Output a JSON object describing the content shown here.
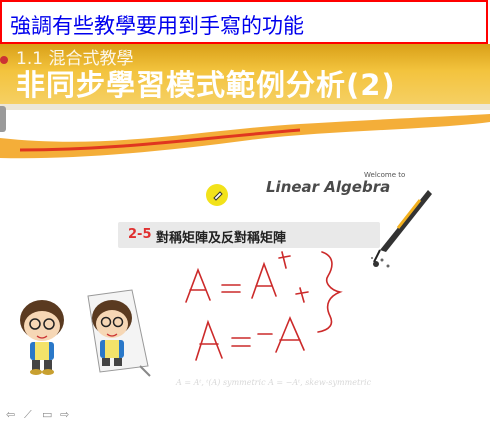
{
  "banner": {
    "text": "強調有些教學要用到手寫的功能"
  },
  "slide_header": {
    "section": "1.1 混合式教學",
    "title": "非同步學習模式範例分析(2)"
  },
  "logo": {
    "welcome": "Welcome to",
    "name": "Linear Algebra"
  },
  "topic": {
    "number": "2-5",
    "title": "對稱矩陣及反對稱矩陣"
  },
  "handwriting": {
    "line1": "A = Aᵗ",
    "line2": "A = −Aᵗ"
  },
  "footer_note": "A = Aᵗ, ᵗ(A) symmetric  A = −Aᵗ, skew-symmetric",
  "controls": [
    {
      "icon": "back-arrow-icon",
      "glyph": "⇦"
    },
    {
      "icon": "pen-tool-icon",
      "glyph": "⟋"
    },
    {
      "icon": "screen-icon",
      "glyph": "▭"
    },
    {
      "icon": "forward-arrow-icon",
      "glyph": "⇨"
    }
  ],
  "colors": {
    "banner_border": "#ff0000",
    "banner_text": "#0000ee",
    "header_gold": "#f3c33d",
    "ink_red": "#cc2a2a",
    "topic_number": "#e03030"
  }
}
